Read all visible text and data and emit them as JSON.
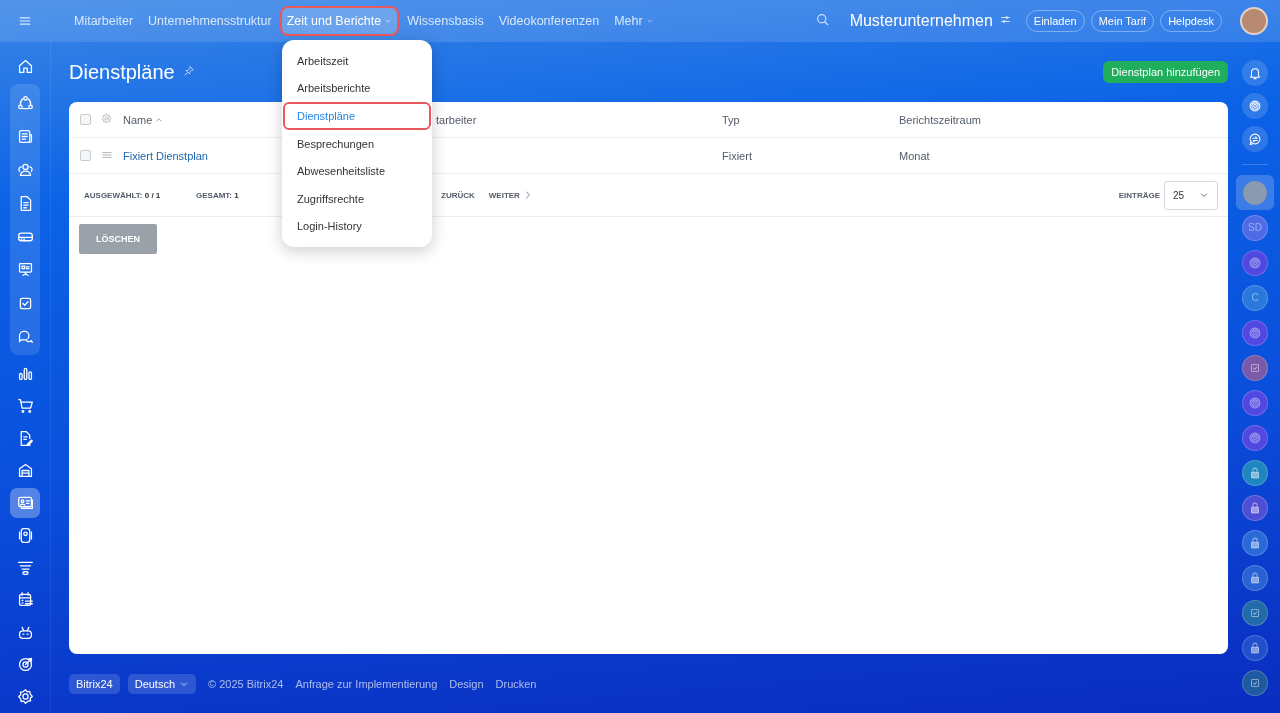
{
  "top_nav": {
    "items": [
      {
        "label": "Mitarbeiter",
        "selected": false,
        "annotated": false,
        "has_caret": false
      },
      {
        "label": "Unternehmensstruktur",
        "selected": false,
        "annotated": false,
        "has_caret": false
      },
      {
        "label": "Zeit und Berichte",
        "selected": true,
        "annotated": true,
        "has_caret": true
      },
      {
        "label": "Wissensbasis",
        "selected": false,
        "annotated": false,
        "has_caret": false
      },
      {
        "label": "Videokonferenzen",
        "selected": false,
        "annotated": false,
        "has_caret": false
      },
      {
        "label": "Mehr",
        "selected": false,
        "annotated": false,
        "has_caret": true
      }
    ],
    "company": "Musterunternehmen",
    "buttons": [
      "Einladen",
      "Mein Tarif",
      "Helpdesk"
    ]
  },
  "dropdown": {
    "items": [
      {
        "label": "Arbeitszeit",
        "selected": false,
        "annotated": false
      },
      {
        "label": "Arbeitsberichte",
        "selected": false,
        "annotated": false
      },
      {
        "label": "Dienstpläne",
        "selected": true,
        "annotated": true
      },
      {
        "label": "Besprechungen",
        "selected": false,
        "annotated": false
      },
      {
        "label": "Abwesenheitsliste",
        "selected": false,
        "annotated": false
      },
      {
        "label": "Zugriffsrechte",
        "selected": false,
        "annotated": false
      },
      {
        "label": "Login-History",
        "selected": false,
        "annotated": false
      }
    ]
  },
  "left_nav": {
    "top": [
      {
        "kind": "home",
        "selected": false
      }
    ],
    "pinned": [
      {
        "kind": "flow",
        "selected": false
      },
      {
        "kind": "news",
        "selected": false
      },
      {
        "kind": "people",
        "selected": false
      },
      {
        "kind": "doc",
        "selected": false
      },
      {
        "kind": "drive",
        "selected": false
      },
      {
        "kind": "board",
        "selected": false
      },
      {
        "kind": "task",
        "selected": false
      },
      {
        "kind": "chat",
        "selected": false
      }
    ],
    "rest": [
      {
        "kind": "chart",
        "selected": false
      },
      {
        "kind": "cart",
        "selected": false
      },
      {
        "kind": "sign",
        "selected": false
      },
      {
        "kind": "store",
        "selected": false
      },
      {
        "kind": "card",
        "selected": true
      },
      {
        "kind": "phone",
        "selected": false
      },
      {
        "kind": "funnel",
        "selected": false
      },
      {
        "kind": "calendar",
        "selected": false
      },
      {
        "kind": "robot",
        "selected": false
      },
      {
        "kind": "target",
        "selected": false
      },
      {
        "kind": "settings",
        "selected": false
      }
    ]
  },
  "page": {
    "title": "Dienstpläne",
    "add_button": "Dienstplan hinzufügen",
    "table": {
      "select_all_checked": false,
      "columns": [
        "Name",
        "tarbeiter",
        "Typ",
        "Berichtszeitraum"
      ],
      "rows": [
        {
          "checked": false,
          "name": "Fixiert Dienstplan",
          "type": "Fixiert",
          "period": "Monat"
        }
      ]
    },
    "footer": {
      "selected_label": "AUSGEWÄHLT:",
      "selected_value": "0 / 1",
      "total_label": "GESAMT:",
      "total_value": "1",
      "prev": "ZURÜCK",
      "next": "WEITER",
      "entries_label": "EINTRÄGE",
      "entries_value": "25"
    },
    "delete_button": "LÖSCHEN"
  },
  "right_rail": {
    "tools": [
      {
        "kind": "bell"
      },
      {
        "kind": "swirl"
      },
      {
        "kind": "chat"
      }
    ],
    "chats": [
      {
        "kind": "avatar",
        "selected": true,
        "color": "#3d7be8"
      },
      {
        "kind": "initials",
        "text": "SD",
        "selected": false,
        "color": "#4f6ae6"
      },
      {
        "kind": "swirl",
        "selected": false,
        "color": "#5048e0"
      },
      {
        "kind": "initials",
        "text": "C",
        "selected": false,
        "color": "#2b78dc"
      },
      {
        "kind": "swirl",
        "selected": false,
        "color": "#5048e0"
      },
      {
        "kind": "task",
        "selected": false,
        "color": "#7a5aa8"
      },
      {
        "kind": "swirl",
        "selected": false,
        "color": "#5048e0"
      },
      {
        "kind": "swirl",
        "selected": false,
        "color": "#5048e0"
      },
      {
        "kind": "lock",
        "selected": false,
        "color": "#1f86c0"
      },
      {
        "kind": "lock",
        "selected": false,
        "color": "#4f4fd6"
      },
      {
        "kind": "lock",
        "selected": false,
        "color": "#2a6ad8"
      },
      {
        "kind": "lock",
        "selected": false,
        "color": "#2a62d4"
      },
      {
        "kind": "task",
        "selected": false,
        "color": "#226aa8"
      },
      {
        "kind": "lock",
        "selected": false,
        "color": "#2250cc"
      },
      {
        "kind": "task",
        "selected": false,
        "color": "#1f5aa0"
      }
    ]
  },
  "bottom": {
    "brand": "Bitrix24",
    "language": "Deutsch",
    "copyright": "© 2025 Bitrix24",
    "links": [
      "Anfrage zur Implementierung",
      "Design",
      "Drucken"
    ]
  }
}
